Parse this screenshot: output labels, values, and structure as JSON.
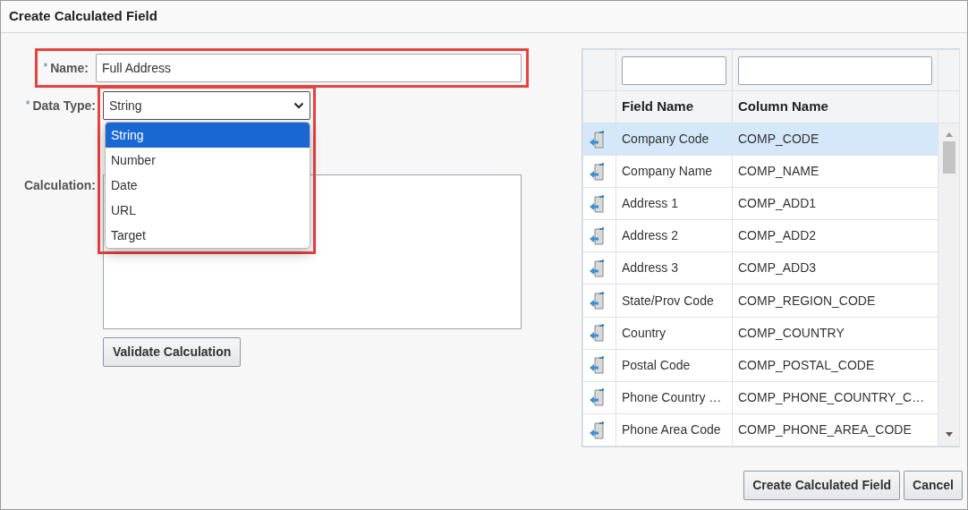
{
  "window": {
    "title": "Create Calculated Field"
  },
  "form": {
    "name": {
      "required_mark": "*",
      "label": "Name:",
      "value": "Full Address",
      "highlighted": true
    },
    "data_type": {
      "required_mark": "*",
      "label": "Data Type:",
      "value": "String",
      "highlighted": true,
      "expanded": true,
      "options": [
        {
          "label": "String",
          "selected": true
        },
        {
          "label": "Number",
          "selected": false
        },
        {
          "label": "Date",
          "selected": false
        },
        {
          "label": "URL",
          "selected": false
        },
        {
          "label": "Target",
          "selected": false
        }
      ]
    },
    "calculation": {
      "label": "Calculation:"
    },
    "validate_button": "Validate Calculation"
  },
  "field_table": {
    "columns": [
      "Field Name",
      "Column Name"
    ],
    "rows": [
      {
        "field_name": "Company Code",
        "column_name": "COMP_CODE",
        "selected": true
      },
      {
        "field_name": "Company Name",
        "column_name": "COMP_NAME",
        "selected": false
      },
      {
        "field_name": "Address 1",
        "column_name": "COMP_ADD1",
        "selected": false
      },
      {
        "field_name": "Address 2",
        "column_name": "COMP_ADD2",
        "selected": false
      },
      {
        "field_name": "Address 3",
        "column_name": "COMP_ADD3",
        "selected": false
      },
      {
        "field_name": "State/Prov Code",
        "column_name": "COMP_REGION_CODE",
        "selected": false
      },
      {
        "field_name": "Country",
        "column_name": "COMP_COUNTRY",
        "selected": false
      },
      {
        "field_name": "Postal Code",
        "column_name": "COMP_POSTAL_CODE",
        "selected": false
      },
      {
        "field_name": "Phone Country …",
        "column_name": "COMP_PHONE_COUNTRY_C…",
        "selected": false
      },
      {
        "field_name": "Phone Area Code",
        "column_name": "COMP_PHONE_AREA_CODE",
        "selected": false
      }
    ]
  },
  "buttons": [
    "Create Calculated Field",
    "Cancel"
  ]
}
